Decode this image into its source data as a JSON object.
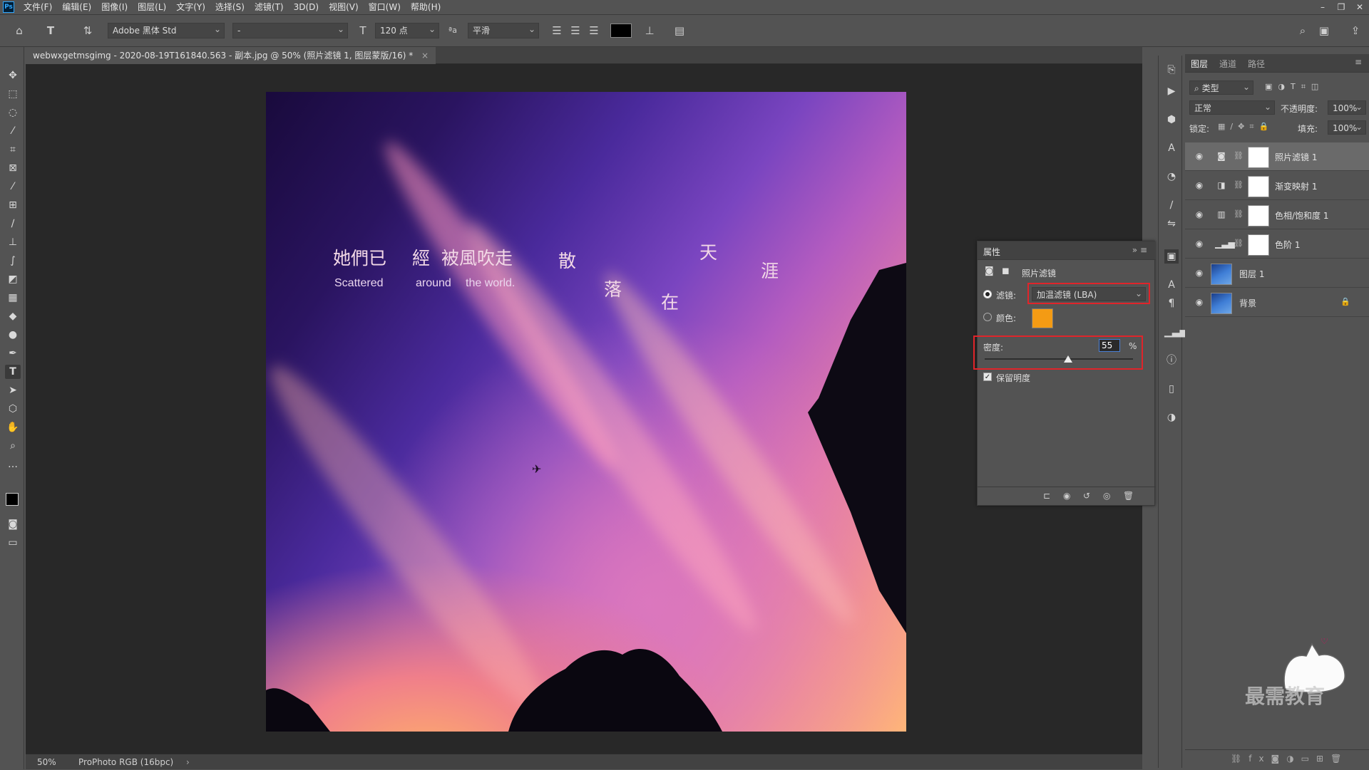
{
  "menubar": {
    "logo": "Ps",
    "items": [
      "文件(F)",
      "编辑(E)",
      "图像(I)",
      "图层(L)",
      "文字(Y)",
      "选择(S)",
      "滤镜(T)",
      "3D(D)",
      "视图(V)",
      "窗口(W)",
      "帮助(H)"
    ]
  },
  "options": {
    "font_family": "Adobe 黑体 Std",
    "font_style": "-",
    "font_size": "120 点",
    "antialias": "平滑",
    "text_color": "#000000"
  },
  "document": {
    "tab_title": "webwxgetmsgimg - 2020-08-19T161840.563 - 副本.jpg @ 50% (照片滤镜 1, 图层蒙版/16) *",
    "tab_close": "×",
    "zoom": "50%",
    "color_profile": "ProPhoto RGB (16bpc)",
    "status_arrow": "›"
  },
  "canvas_text": {
    "cn_1": "她們已",
    "cn_2": "經",
    "cn_3": "被風吹走",
    "cn_4": "散",
    "cn_5": "落",
    "cn_6": "在",
    "cn_7": "天",
    "cn_8": "涯",
    "en_1": "Scattered",
    "en_2": "around",
    "en_3": "the world."
  },
  "properties": {
    "tab": "属性",
    "title": "照片滤镜",
    "filter_label": "滤镜:",
    "filter_value": "加温滤镜 (LBA)",
    "color_label": "颜色:",
    "color_swatch": "#f49b14",
    "density_label": "密度:",
    "density_value": "55",
    "density_unit": "%",
    "preserve_label": "保留明度"
  },
  "layers_panel": {
    "tabs": [
      "图层",
      "通道",
      "路径"
    ],
    "filter_kind": "类型",
    "blend_mode": "正常",
    "opacity_label": "不透明度:",
    "opacity_value": "100%",
    "lock_label": "锁定:",
    "fill_label": "填充:",
    "fill_value": "100%",
    "layers": [
      {
        "name": "照片滤镜 1"
      },
      {
        "name": "渐变映射 1"
      },
      {
        "name": "色相/饱和度 1"
      },
      {
        "name": "色阶 1"
      },
      {
        "name": "图层 1"
      },
      {
        "name": "背景"
      }
    ]
  },
  "watermark": "最需教育"
}
